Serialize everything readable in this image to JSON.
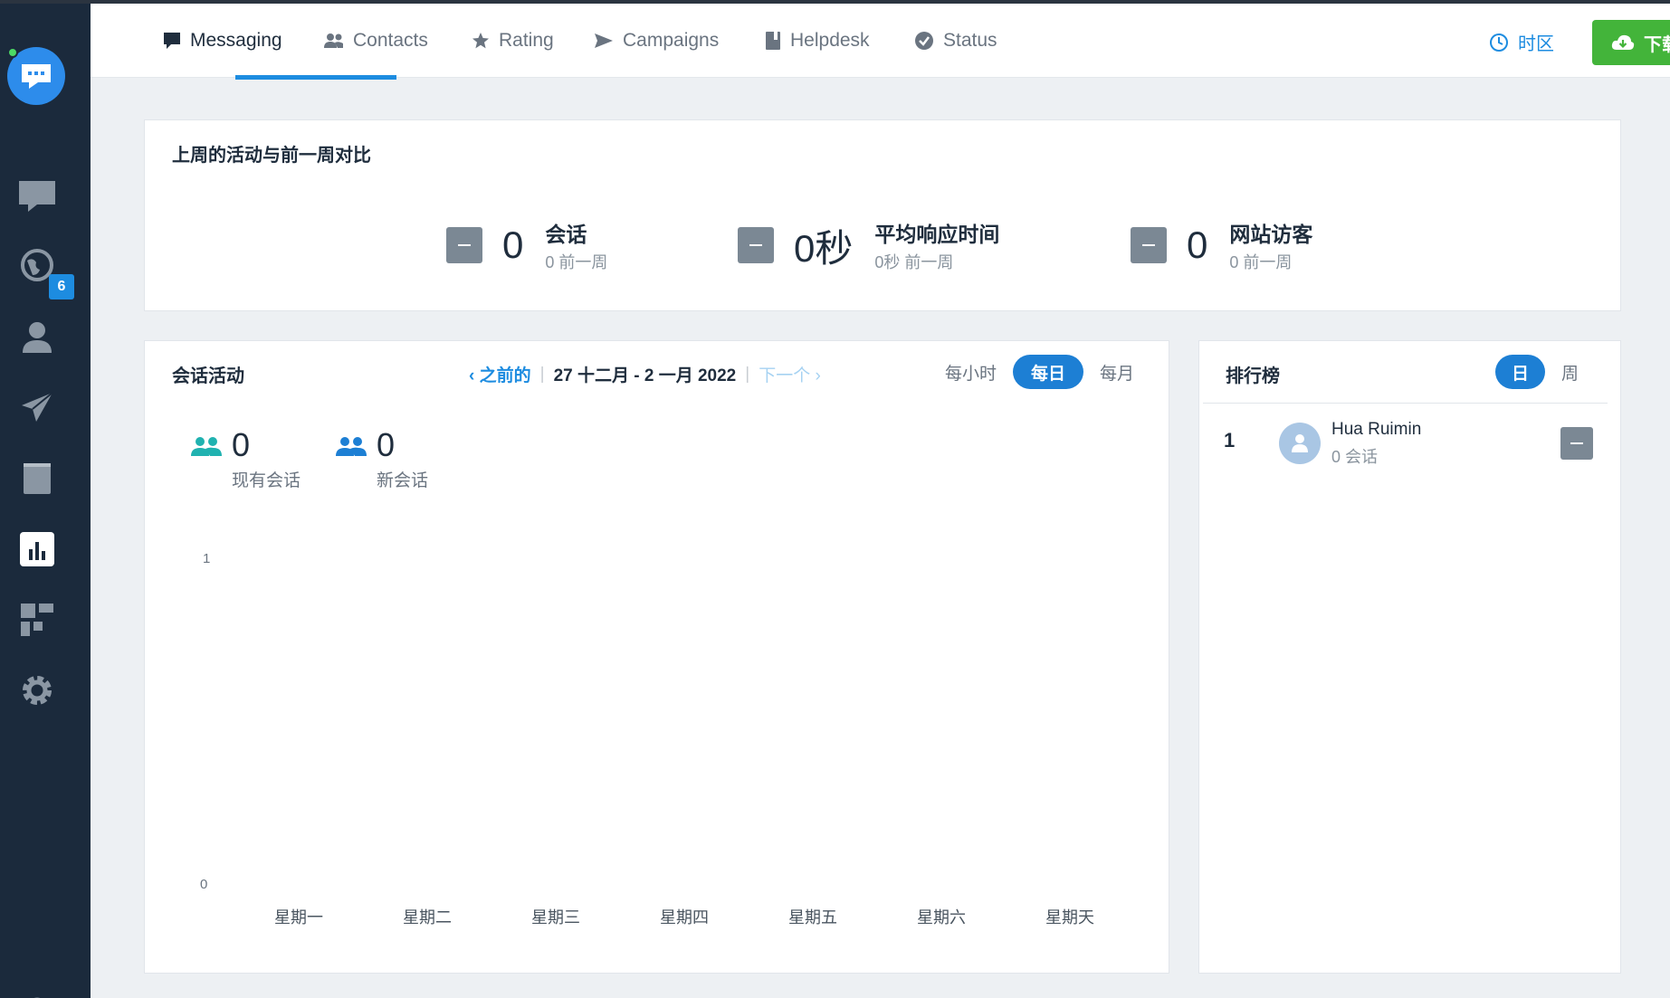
{
  "nav": {
    "tabs": [
      {
        "label": "Messaging",
        "icon": "chat-icon"
      },
      {
        "label": "Contacts",
        "icon": "people-icon"
      },
      {
        "label": "Rating",
        "icon": "star-icon"
      },
      {
        "label": "Campaigns",
        "icon": "send-icon"
      },
      {
        "label": "Helpdesk",
        "icon": "book-icon"
      },
      {
        "label": "Status",
        "icon": "check-circle-icon"
      }
    ],
    "active_tab": "Messaging",
    "timezone_label": "时区",
    "download_label": "下载报告"
  },
  "sidebar": {
    "badge_count": "6",
    "items": [
      "chat-icon",
      "globe-icon",
      "user-icon",
      "send-icon",
      "book-icon",
      "chart-icon",
      "apps-icon",
      "gear-icon"
    ],
    "active_item": "chart-icon"
  },
  "weekly": {
    "title": "上周的活动与前一周对比",
    "metrics": [
      {
        "value": "0",
        "label": "会话",
        "sub": "0 前一周"
      },
      {
        "value": "0秒",
        "label": "平均响应时间",
        "sub": "0秒 前一周"
      },
      {
        "value": "0",
        "label": "网站访客",
        "sub": "0 前一周"
      }
    ]
  },
  "activity": {
    "title": "会话活动",
    "prev_label": "之前的",
    "range_label": "27 十二月 - 2 一月 2022",
    "next_label": "下一个",
    "granularity": [
      "每小时",
      "每日",
      "每月"
    ],
    "selected_granularity": "每日",
    "stats": [
      {
        "value": "0",
        "label": "现有会话",
        "color": "#20b2b0"
      },
      {
        "value": "0",
        "label": "新会话",
        "color": "#1d7fd4"
      }
    ]
  },
  "chart_data": {
    "type": "bar",
    "categories": [
      "星期一",
      "星期二",
      "星期三",
      "星期四",
      "星期五",
      "星期六",
      "星期天"
    ],
    "series": [
      {
        "name": "现有会话",
        "values": [
          0,
          0,
          0,
          0,
          0,
          0,
          0
        ]
      },
      {
        "name": "新会话",
        "values": [
          0,
          0,
          0,
          0,
          0,
          0,
          0
        ]
      }
    ],
    "yticks": [
      "1",
      "0"
    ],
    "ylim": [
      0,
      1
    ],
    "grid": false
  },
  "leaderboard": {
    "title": "排行榜",
    "toggle": [
      "日",
      "周"
    ],
    "selected": "日",
    "rows": [
      {
        "rank": "1",
        "name": "Hua Ruimin",
        "sub": "0 会话"
      }
    ]
  },
  "colors": {
    "accent": "#1d8ce0",
    "success": "#43b43a",
    "sidebar": "#1b2a3c"
  }
}
